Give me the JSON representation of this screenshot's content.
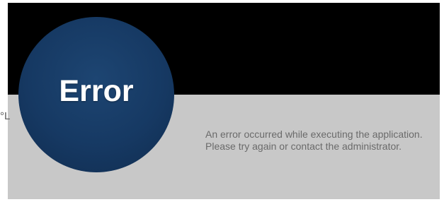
{
  "error": {
    "title": "Error",
    "message_line_1": "An error occurred while executing the application.",
    "message_line_2": "Please try again or contact the administrator."
  },
  "stray_text": "°L",
  "colors": {
    "header_band": "#000000",
    "content_band": "#c8c8c8",
    "circle": "#163963",
    "message_text": "#6a6a6a"
  }
}
